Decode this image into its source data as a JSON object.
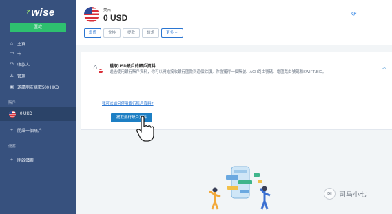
{
  "sidebar": {
    "logo": "wise",
    "send_label": "匯款",
    "nav": [
      {
        "label": "主頁",
        "icon": "home-icon"
      },
      {
        "label": "卡",
        "icon": "card-icon"
      },
      {
        "label": "收款人",
        "icon": "recipients-icon"
      },
      {
        "label": "管理",
        "icon": "manage-icon"
      },
      {
        "label": "邀請朋友賺取500 HKD",
        "icon": "gift-icon"
      }
    ],
    "accounts_section": "賬戶",
    "account_item": "0 USD",
    "open_account": "開設一個賬戶",
    "jars_section": "儲蓄",
    "open_jar": "開啟儲蓄"
  },
  "header": {
    "currency_label": "美元",
    "balance": "0 USD",
    "actions": [
      "增值",
      "兌換",
      "提款",
      "請求",
      "更多 ⋯"
    ]
  },
  "card": {
    "title": "獲取USD賬戶的賬戶資料",
    "desc": "透過使用銀行賬戶資料，你可以開始接收銀行匯款到這個餘額。你會獲得一個賬號、ACH路由號碼、電匯路由號碼和SWIFT/BIC。",
    "link": "我可以如何使用銀行賬戶資料?",
    "button": "獲取銀行賬戶資料"
  },
  "watermark": "司马小七",
  "colors": {
    "sidebar": "#37517e",
    "accent": "#2b76d2",
    "send": "#2ec06f"
  }
}
